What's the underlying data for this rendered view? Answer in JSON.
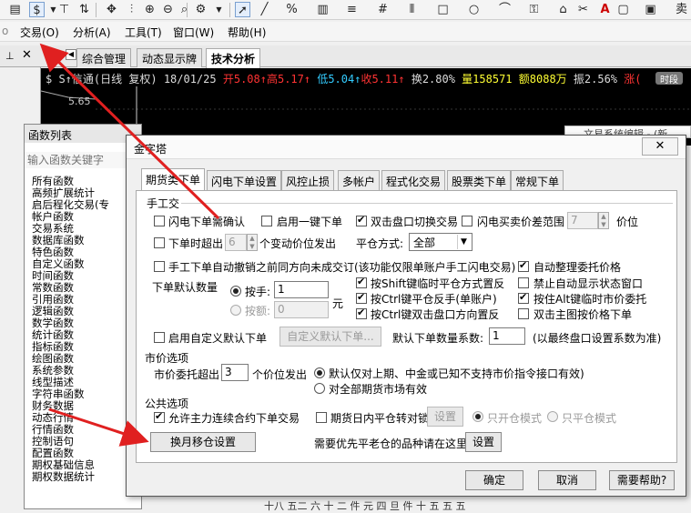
{
  "toolbar": {
    "icons": [
      "document-icon",
      "dollar-icon",
      "filter-icon",
      "refresh-icon",
      "move-icon",
      "cursor-bar-icon",
      "zoom-in-icon",
      "zoom-out-icon",
      "search-icon",
      "settings-icon",
      "pointer-icon",
      "line-draw-icon",
      "percent-icon",
      "columns-icon",
      "grid-icon",
      "rect-icon",
      "circle-icon",
      "text-icon",
      "lock-icon",
      "home-icon",
      "text-color-icon",
      "sell-icon"
    ],
    "text_color_letter": "A",
    "last_label": "卖"
  },
  "menubar": {
    "items": [
      {
        "label": "交易(O)"
      },
      {
        "label": "分析(A)"
      },
      {
        "label": "工具(T)"
      },
      {
        "label": "窗口(W)"
      },
      {
        "label": "帮助(H)"
      }
    ]
  },
  "tabbar": {
    "tabs": [
      {
        "label": "综合管理"
      },
      {
        "label": "动态显示牌"
      },
      {
        "label": "技术分析"
      }
    ]
  },
  "chart_header": {
    "name": "$ S↑信通(日线 复权)",
    "date": "18/01/25",
    "open": "开5.08↑",
    "high": "高5.17↑",
    "low": "低5.04↑",
    "close": "收5.11↑",
    "turnover": "换2.80%",
    "volume": "量158571",
    "amount": "额8088万",
    "amplitude": "振2.56%",
    "change": "涨(",
    "price_label": "5.65"
  },
  "function_panel": {
    "title": "函数列表",
    "search_placeholder": "输入函数关键字",
    "items": [
      "所有函数",
      "高频扩展统计",
      "启后程化交易(专",
      "帐户函数",
      "交易系统",
      "数据库函数",
      "特色函数",
      "自定义函数",
      "时间函数",
      "常数函数",
      "引用函数",
      "逻辑函数",
      "数学函数",
      "统计函数",
      "指标函数",
      "绘图函数",
      "系统参数",
      "线型描述",
      "字符串函数",
      "财务数据",
      "动态行情",
      "行情函数",
      "控制语句",
      "配置函数",
      "期权基础信息",
      "期权数据统计"
    ]
  },
  "background": {
    "bottom_text": "十八 五二 六 十 二 件 元 四 旦 件 十 五 五 五"
  },
  "dialog": {
    "title": "金字塔",
    "close_label": "✕",
    "tabs": [
      "期货类下单",
      "闪电下单设置",
      "风控止损",
      "多帐户",
      "程式化交易",
      "股票类下单",
      "常规下单"
    ],
    "manual": {
      "section": "手工交",
      "lightning_confirm": "闪电下单需确认",
      "one_key": "启用一键下单",
      "dblclick_switch": "双击盘口切换交易",
      "lightning_range": "闪电买卖价差范围",
      "lightning_range_value": "7",
      "price_unit": "价位",
      "timeout": "下单时超出",
      "timeout_value": "6",
      "timeout_suffix": "个变动价位发出",
      "close_mode_label": "平仓方式:",
      "close_mode_value": "全部",
      "auto_cancel": "手工下单自动撤销之前同方向未成交订(该功能仅限单账户手工闪电交易)",
      "auto_arrange": "自动整理委托价格",
      "default_qty_label": "下单默认数量",
      "by_hand": "按手:",
      "by_hand_value": "1",
      "by_amount": "按额:",
      "by_amount_value": "0",
      "yuan": "元",
      "shift_close": "按Shift键临时平仓方式置反",
      "no_status_window": "禁止自动显示状态窗口",
      "ctrl_reverse": "按Ctrl键平仓反手(单账户)",
      "alt_market": "按住Alt键临时市价委托",
      "ctrl_dblclick": "按Ctrl键双击盘口方向置反",
      "dblclick_main": "双击主图按价格下单",
      "custom_default": "启用自定义默认下单",
      "custom_default_btn": "自定义默认下单...",
      "qty_factor_label": "默认下单数量系数:",
      "qty_factor_value": "1",
      "qty_factor_note": "(以最终盘口设置系数为准)"
    },
    "market": {
      "section": "市价选项",
      "exceed_label": "市价委托超出",
      "exceed_value": "3",
      "exceed_suffix": "个价位发出",
      "opt_recent": "默认仅对上期、中金或已知不支持市价指令接口有效)",
      "opt_all": "对全部期货市场有效"
    },
    "common": {
      "section": "公共选项",
      "allow_main": "允许主力连续合约下单交易",
      "intraday_close": "期货日内平仓转对锁",
      "intraday_setting": "设置",
      "open_mode": "只开仓模式",
      "close_mode": "只平仓模式",
      "rollover_btn": "换月移仓设置",
      "priority_note": "需要优先平老仓的品种请在这里",
      "priority_btn": "设置"
    },
    "buttons": {
      "ok": "确定",
      "cancel": "取消",
      "help": "需要帮助?"
    }
  }
}
